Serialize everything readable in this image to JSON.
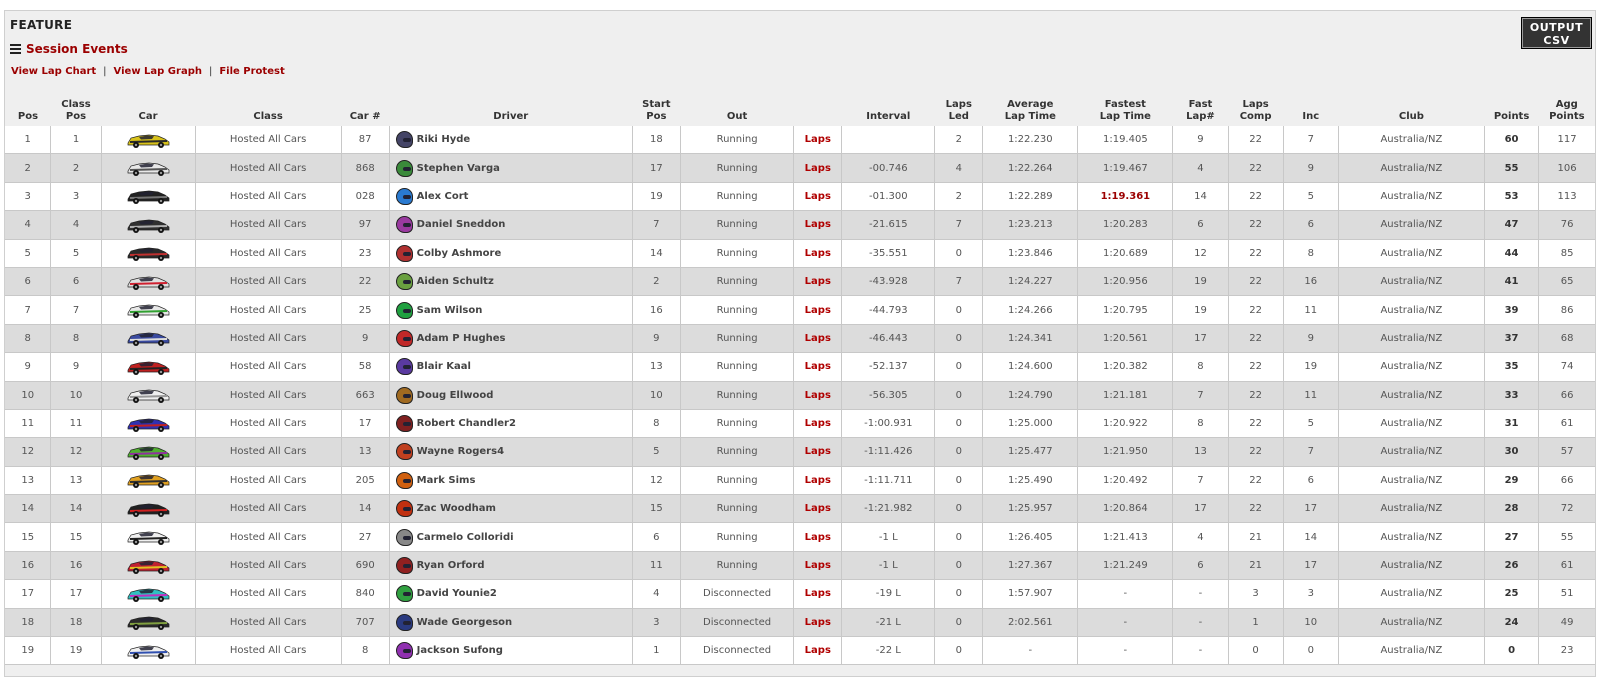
{
  "header": {
    "title": "FEATURE",
    "session_events": "Session Events",
    "links": [
      "View Lap Chart",
      "View Lap Graph",
      "File Protest"
    ],
    "output_csv_line1": "OUTPUT",
    "output_csv_line2": "CSV"
  },
  "columns": [
    {
      "key": "pos",
      "label": "Pos"
    },
    {
      "key": "class_pos",
      "label": "Class Pos"
    },
    {
      "key": "car",
      "label": "Car"
    },
    {
      "key": "class",
      "label": "Class"
    },
    {
      "key": "car_num",
      "label": "Car #"
    },
    {
      "key": "driver",
      "label": "Driver"
    },
    {
      "key": "start_pos",
      "label": "Start\nPos"
    },
    {
      "key": "out",
      "label": "Out"
    },
    {
      "key": "laps",
      "label": ""
    },
    {
      "key": "interval",
      "label": "Interval"
    },
    {
      "key": "laps_led",
      "label": "Laps\nLed"
    },
    {
      "key": "avg_lap",
      "label": "Average\nLap Time"
    },
    {
      "key": "fast_lap",
      "label": "Fastest\nLap Time"
    },
    {
      "key": "fast_lap_num",
      "label": "Fast\nLap#"
    },
    {
      "key": "laps_comp",
      "label": "Laps\nComp"
    },
    {
      "key": "inc",
      "label": "Inc"
    },
    {
      "key": "club",
      "label": "Club"
    },
    {
      "key": "points",
      "label": "Points"
    },
    {
      "key": "agg_points",
      "label": "Agg\nPoints"
    }
  ],
  "rows": [
    {
      "pos": "1",
      "class_pos": "1",
      "car_color": "#d8c21a",
      "car_accent": "#2a2a2a",
      "class": "Hosted All Cars",
      "car_num": "87",
      "helmet": "#444466",
      "driver": "Riki Hyde",
      "start_pos": "18",
      "out": "Running",
      "laps": "Laps",
      "interval": "",
      "laps_led": "2",
      "avg_lap": "1:22.230",
      "fast_lap": "1:19.405",
      "fast_lap_num": "9",
      "laps_comp": "22",
      "inc": "7",
      "club": "Australia/NZ",
      "points": "60",
      "agg_points": "117"
    },
    {
      "pos": "2",
      "class_pos": "2",
      "car_color": "#e8e8e8",
      "car_accent": "#555555",
      "class": "Hosted All Cars",
      "car_num": "868",
      "helmet": "#3a8a3a",
      "driver": "Stephen Varga",
      "start_pos": "17",
      "out": "Running",
      "laps": "Laps",
      "interval": "-00.746",
      "laps_led": "4",
      "avg_lap": "1:22.264",
      "fast_lap": "1:19.467",
      "fast_lap_num": "4",
      "laps_comp": "22",
      "inc": "9",
      "club": "Australia/NZ",
      "points": "55",
      "agg_points": "106"
    },
    {
      "pos": "3",
      "class_pos": "3",
      "car_color": "#222222",
      "car_accent": "#777777",
      "class": "Hosted All Cars",
      "car_num": "028",
      "helmet": "#2a7ad0",
      "driver": "Alex Cort",
      "start_pos": "19",
      "out": "Running",
      "laps": "Laps",
      "interval": "-01.300",
      "laps_led": "2",
      "avg_lap": "1:22.289",
      "fast_lap": "1:19.361",
      "fast_best": true,
      "fast_lap_num": "14",
      "laps_comp": "22",
      "inc": "5",
      "club": "Australia/NZ",
      "points": "53",
      "agg_points": "113"
    },
    {
      "pos": "4",
      "class_pos": "4",
      "car_color": "#303030",
      "car_accent": "#b0b0b0",
      "class": "Hosted All Cars",
      "car_num": "97",
      "helmet": "#9a3aa0",
      "driver": "Daniel Sneddon",
      "start_pos": "7",
      "out": "Running",
      "laps": "Laps",
      "interval": "-21.615",
      "laps_led": "7",
      "avg_lap": "1:23.213",
      "fast_lap": "1:20.283",
      "fast_lap_num": "6",
      "laps_comp": "22",
      "inc": "6",
      "club": "Australia/NZ",
      "points": "47",
      "agg_points": "76"
    },
    {
      "pos": "5",
      "class_pos": "5",
      "car_color": "#2a2a2a",
      "car_accent": "#c03030",
      "class": "Hosted All Cars",
      "car_num": "23",
      "helmet": "#b03030",
      "driver": "Colby Ashmore",
      "start_pos": "14",
      "out": "Running",
      "laps": "Laps",
      "interval": "-35.551",
      "laps_led": "0",
      "avg_lap": "1:23.846",
      "fast_lap": "1:20.689",
      "fast_lap_num": "12",
      "laps_comp": "22",
      "inc": "8",
      "club": "Australia/NZ",
      "points": "44",
      "agg_points": "85"
    },
    {
      "pos": "6",
      "class_pos": "6",
      "car_color": "#e0e0e0",
      "car_accent": "#d02030",
      "class": "Hosted All Cars",
      "car_num": "22",
      "helmet": "#6aa040",
      "driver": "Aiden Schultz",
      "start_pos": "2",
      "out": "Running",
      "laps": "Laps",
      "interval": "-43.928",
      "laps_led": "7",
      "avg_lap": "1:24.227",
      "fast_lap": "1:20.956",
      "fast_lap_num": "19",
      "laps_comp": "22",
      "inc": "16",
      "club": "Australia/NZ",
      "points": "41",
      "agg_points": "65"
    },
    {
      "pos": "7",
      "class_pos": "7",
      "car_color": "#e8e8e8",
      "car_accent": "#30a030",
      "class": "Hosted All Cars",
      "car_num": "25",
      "helmet": "#20a040",
      "driver": "Sam Wilson",
      "start_pos": "16",
      "out": "Running",
      "laps": "Laps",
      "interval": "-44.793",
      "laps_led": "0",
      "avg_lap": "1:24.266",
      "fast_lap": "1:20.795",
      "fast_lap_num": "19",
      "laps_comp": "22",
      "inc": "11",
      "club": "Australia/NZ",
      "points": "39",
      "agg_points": "86"
    },
    {
      "pos": "8",
      "class_pos": "8",
      "car_color": "#3a4aa0",
      "car_accent": "#dddddd",
      "class": "Hosted All Cars",
      "car_num": "9",
      "helmet": "#c02828",
      "driver": "Adam P Hughes",
      "start_pos": "9",
      "out": "Running",
      "laps": "Laps",
      "interval": "-46.443",
      "laps_led": "0",
      "avg_lap": "1:24.341",
      "fast_lap": "1:20.561",
      "fast_lap_num": "17",
      "laps_comp": "22",
      "inc": "9",
      "club": "Australia/NZ",
      "points": "37",
      "agg_points": "68"
    },
    {
      "pos": "9",
      "class_pos": "9",
      "car_color": "#c02020",
      "car_accent": "#222222",
      "class": "Hosted All Cars",
      "car_num": "58",
      "helmet": "#5a3aa0",
      "driver": "Blair Kaal",
      "start_pos": "13",
      "out": "Running",
      "laps": "Laps",
      "interval": "-52.137",
      "laps_led": "0",
      "avg_lap": "1:24.600",
      "fast_lap": "1:20.382",
      "fast_lap_num": "8",
      "laps_comp": "22",
      "inc": "19",
      "club": "Australia/NZ",
      "points": "35",
      "agg_points": "74"
    },
    {
      "pos": "10",
      "class_pos": "10",
      "car_color": "#f0f0f0",
      "car_accent": "#999999",
      "class": "Hosted All Cars",
      "car_num": "663",
      "helmet": "#a06a20",
      "driver": "Doug Ellwood",
      "start_pos": "10",
      "out": "Running",
      "laps": "Laps",
      "interval": "-56.305",
      "laps_led": "0",
      "avg_lap": "1:24.790",
      "fast_lap": "1:21.181",
      "fast_lap_num": "7",
      "laps_comp": "22",
      "inc": "11",
      "club": "Australia/NZ",
      "points": "33",
      "agg_points": "66"
    },
    {
      "pos": "11",
      "class_pos": "11",
      "car_color": "#3030b0",
      "car_accent": "#c02020",
      "class": "Hosted All Cars",
      "car_num": "17",
      "helmet": "#802020",
      "driver": "Robert Chandler2",
      "start_pos": "8",
      "out": "Running",
      "laps": "Laps",
      "interval": "-1:00.931",
      "laps_led": "0",
      "avg_lap": "1:25.000",
      "fast_lap": "1:20.922",
      "fast_lap_num": "8",
      "laps_comp": "22",
      "inc": "5",
      "club": "Australia/NZ",
      "points": "31",
      "agg_points": "61"
    },
    {
      "pos": "12",
      "class_pos": "12",
      "car_color": "#50b030",
      "car_accent": "#9030a0",
      "class": "Hosted All Cars",
      "car_num": "13",
      "helmet": "#c04020",
      "driver": "Wayne Rogers4",
      "start_pos": "5",
      "out": "Running",
      "laps": "Laps",
      "interval": "-1:11.426",
      "laps_led": "0",
      "avg_lap": "1:25.477",
      "fast_lap": "1:21.950",
      "fast_lap_num": "13",
      "laps_comp": "22",
      "inc": "7",
      "club": "Australia/NZ",
      "points": "30",
      "agg_points": "57"
    },
    {
      "pos": "13",
      "class_pos": "13",
      "car_color": "#e0a020",
      "car_accent": "#303030",
      "class": "Hosted All Cars",
      "car_num": "205",
      "helmet": "#d06010",
      "driver": "Mark Sims",
      "start_pos": "12",
      "out": "Running",
      "laps": "Laps",
      "interval": "-1:11.711",
      "laps_led": "0",
      "avg_lap": "1:25.490",
      "fast_lap": "1:20.492",
      "fast_lap_num": "7",
      "laps_comp": "22",
      "inc": "6",
      "club": "Australia/NZ",
      "points": "29",
      "agg_points": "66"
    },
    {
      "pos": "14",
      "class_pos": "14",
      "car_color": "#202020",
      "car_accent": "#d02020",
      "class": "Hosted All Cars",
      "car_num": "14",
      "helmet": "#c03010",
      "driver": "Zac Woodham",
      "start_pos": "15",
      "out": "Running",
      "laps": "Laps",
      "interval": "-1:21.982",
      "laps_led": "0",
      "avg_lap": "1:25.957",
      "fast_lap": "1:20.864",
      "fast_lap_num": "17",
      "laps_comp": "22",
      "inc": "17",
      "club": "Australia/NZ",
      "points": "28",
      "agg_points": "72"
    },
    {
      "pos": "15",
      "class_pos": "15",
      "car_color": "#f0f0f0",
      "car_accent": "#202020",
      "class": "Hosted All Cars",
      "car_num": "27",
      "helmet": "#888888",
      "driver": "Carmelo Colloridi",
      "start_pos": "6",
      "out": "Running",
      "laps": "Laps",
      "interval": "-1 L",
      "laps_led": "0",
      "avg_lap": "1:26.405",
      "fast_lap": "1:21.413",
      "fast_lap_num": "4",
      "laps_comp": "21",
      "inc": "14",
      "club": "Australia/NZ",
      "points": "27",
      "agg_points": "55"
    },
    {
      "pos": "16",
      "class_pos": "16",
      "car_color": "#c02030",
      "car_accent": "#e0c020",
      "class": "Hosted All Cars",
      "car_num": "690",
      "helmet": "#902020",
      "driver": "Ryan Orford",
      "start_pos": "11",
      "out": "Running",
      "laps": "Laps",
      "interval": "-1 L",
      "laps_led": "0",
      "avg_lap": "1:27.367",
      "fast_lap": "1:21.249",
      "fast_lap_num": "6",
      "laps_comp": "21",
      "inc": "17",
      "club": "Australia/NZ",
      "points": "26",
      "agg_points": "61"
    },
    {
      "pos": "17",
      "class_pos": "17",
      "car_color": "#30c0c0",
      "car_accent": "#c030c0",
      "class": "Hosted All Cars",
      "car_num": "840",
      "helmet": "#30a040",
      "driver": "David Younie2",
      "start_pos": "4",
      "out": "Disconnected",
      "laps": "Laps",
      "interval": "-19 L",
      "laps_led": "0",
      "avg_lap": "1:57.907",
      "fast_lap": "-",
      "fast_lap_num": "-",
      "laps_comp": "3",
      "inc": "3",
      "club": "Australia/NZ",
      "points": "25",
      "agg_points": "51"
    },
    {
      "pos": "18",
      "class_pos": "18",
      "car_color": "#2a2a2a",
      "car_accent": "#80a040",
      "class": "Hosted All Cars",
      "car_num": "707",
      "helmet": "#2a3a80",
      "driver": "Wade Georgeson",
      "start_pos": "3",
      "out": "Disconnected",
      "laps": "Laps",
      "interval": "-21 L",
      "laps_led": "0",
      "avg_lap": "2:02.561",
      "fast_lap": "-",
      "fast_lap_num": "-",
      "laps_comp": "1",
      "inc": "10",
      "club": "Australia/NZ",
      "points": "24",
      "agg_points": "49"
    },
    {
      "pos": "19",
      "class_pos": "19",
      "car_color": "#f0f0f0",
      "car_accent": "#3050b0",
      "class": "Hosted All Cars",
      "car_num": "8",
      "helmet": "#9030b0",
      "driver": "Jackson Sufong",
      "start_pos": "1",
      "out": "Disconnected",
      "laps": "Laps",
      "interval": "-22 L",
      "laps_led": "0",
      "avg_lap": "-",
      "fast_lap": "-",
      "fast_lap_num": "-",
      "laps_comp": "0",
      "inc": "0",
      "club": "Australia/NZ",
      "points": "0",
      "agg_points": "23"
    }
  ]
}
